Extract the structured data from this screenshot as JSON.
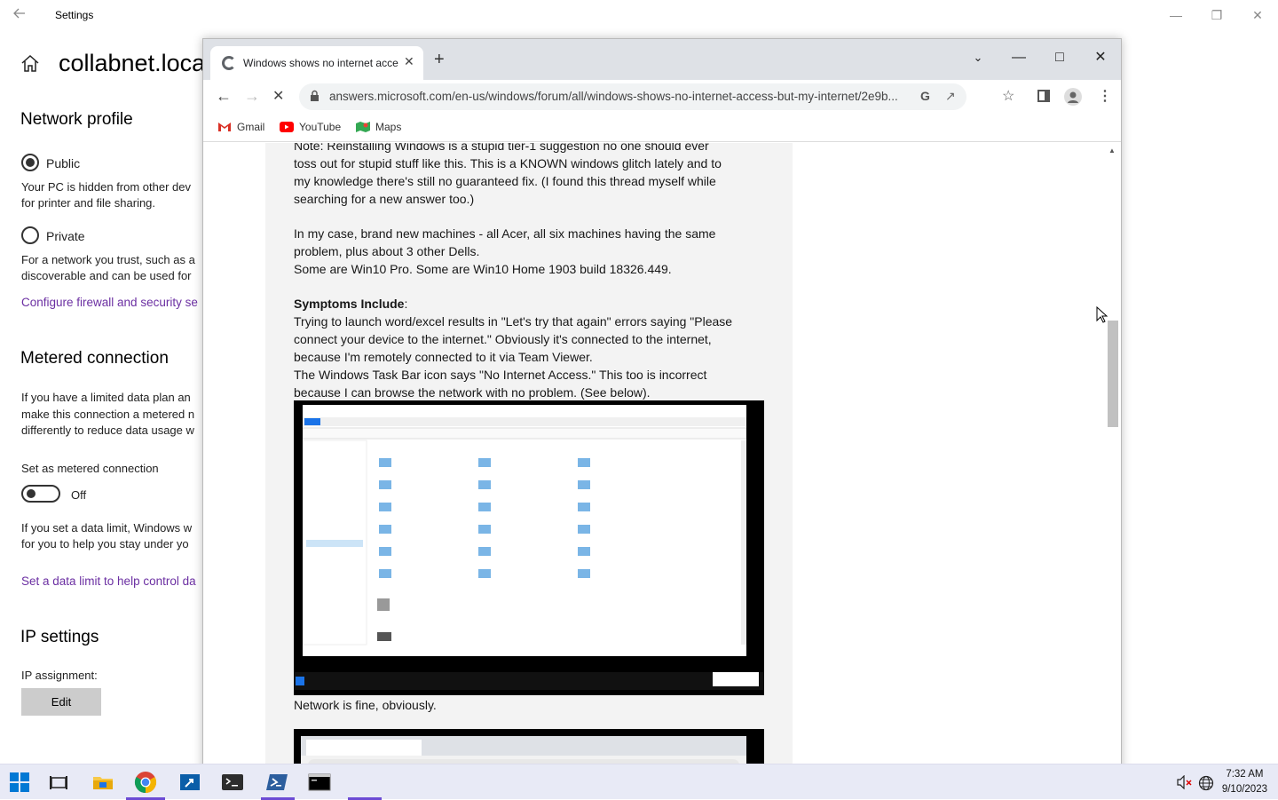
{
  "settings": {
    "title": "Settings",
    "heading": "collabnet.loca",
    "network_profile": {
      "title": "Network profile",
      "public_label": "Public",
      "public_desc_line1": "Your PC is hidden from other dev",
      "public_desc_line2": "for printer and file sharing.",
      "private_label": "Private",
      "private_desc_line1": "For a network you trust, such as a",
      "private_desc_line2": "discoverable and can be used for",
      "firewall_link": "Configure firewall and security se"
    },
    "metered": {
      "title": "Metered connection",
      "desc_line1": "If you have a limited data plan an",
      "desc_line2": "make this connection a metered n",
      "desc_line3": "differently to reduce data usage w",
      "set_label": "Set as metered connection",
      "toggle_state": "Off",
      "limit_line1": "If you set a data limit, Windows w",
      "limit_line2": "for you to help you stay under yo",
      "limit_link": "Set a data limit to help control da"
    },
    "ip": {
      "title": "IP settings",
      "assignment_label": "IP assignment:",
      "edit_button": "Edit"
    }
  },
  "browser": {
    "tab_title": "Windows shows no internet acce",
    "url": "answers.microsoft.com/en-us/windows/forum/all/windows-shows-no-internet-access-but-my-internet/2e9b...",
    "bookmarks": [
      {
        "label": "Gmail",
        "icon": "gmail-icon"
      },
      {
        "label": "YouTube",
        "icon": "youtube-icon"
      },
      {
        "label": "Maps",
        "icon": "maps-icon"
      }
    ],
    "post": {
      "line1": "Note: Reinstalling Windows is a stupid tier-1 suggestion no one should ever",
      "line2": "toss out for stupid stuff like this. This is a KNOWN windows glitch lately and to",
      "line3": "my knowledge there's still no guaranteed fix. (I found this thread myself while",
      "line4": "searching for a new answer too.)",
      "line5": "In my case, brand new machines - all Acer, all six machines having the same",
      "line6": "problem, plus about 3 other Dells.",
      "line7": "Some are Win10 Pro. Some are Win10 Home 1903 build 18326.449.",
      "symptoms_heading": "Symptoms Include",
      "symptoms_colon": ":",
      "line8": "Trying to launch word/excel results in \"Let's try that again\" errors saying \"Please",
      "line9": "connect your device to the internet.\" Obviously it's connected to the internet,",
      "line10": "because I'm remotely connected to it via Team Viewer.",
      "line11": "The Windows Task Bar icon says \"No Internet Access.\" This too is incorrect",
      "line12": "because I can browse the network with no problem. (See below).",
      "caption": "Network is fine, obviously."
    },
    "scroll_fraction": 0.33
  },
  "taskbar": {
    "time": "7:32 AM",
    "date": "9/10/2023"
  }
}
